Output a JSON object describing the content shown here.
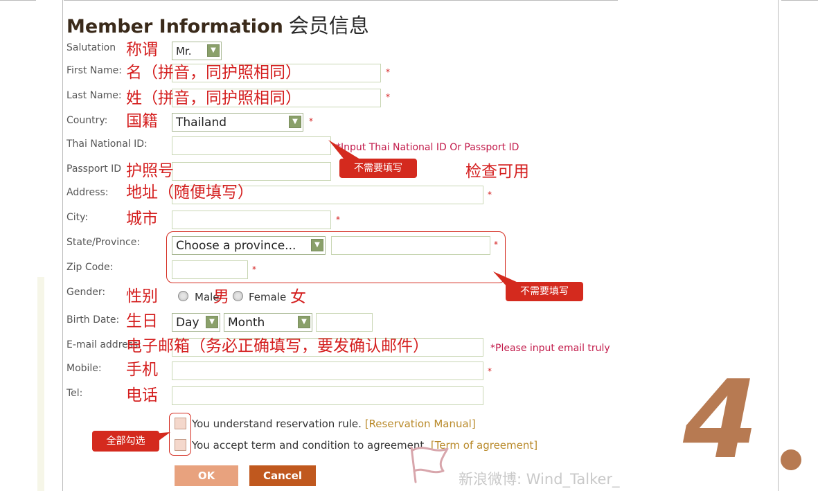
{
  "form": {
    "title": "Member Information",
    "title_cn": "会员信息",
    "salutation": {
      "label": "Salutation",
      "cn": "称谓",
      "value": "Mr."
    },
    "first_name": {
      "label": "First Name:",
      "cn": "名（拼音，同护照相同）",
      "required": "*"
    },
    "last_name": {
      "label": "Last Name:",
      "cn": "姓（拼音，同护照相同）",
      "required": "*"
    },
    "country": {
      "label": "Country:",
      "cn": "国籍",
      "value": "Thailand",
      "required": "*"
    },
    "thai_id": {
      "label": "Thai National ID:",
      "hint": "*Input Thai National ID Or Passport ID"
    },
    "passport": {
      "label": "Passport ID",
      "cn": "护照号",
      "note_cn": "检查可用"
    },
    "address": {
      "label": "Address:",
      "cn": "地址（随便填写）",
      "required": "*"
    },
    "city": {
      "label": "City:",
      "cn": "城市",
      "required": "*"
    },
    "state": {
      "label": "State/Province:",
      "value": "Choose a province...",
      "required": "*"
    },
    "zip": {
      "label": "Zip Code:",
      "required": "*"
    },
    "gender": {
      "label": "Gender:",
      "cn": "性别",
      "male": "Male",
      "male_cn": "男",
      "female": "Female",
      "female_cn": "女"
    },
    "birth": {
      "label": "Birth Date:",
      "cn": "生日",
      "day": "Day",
      "month": "Month"
    },
    "email": {
      "label": "E-mail address:",
      "cn": "电子邮箱（务必正确填写，要发确认邮件）",
      "hint": "*Please input email truly"
    },
    "mobile": {
      "label": "Mobile:",
      "cn": "手机",
      "required": "*"
    },
    "tel": {
      "label": "Tel:",
      "cn": "电话"
    },
    "agree1": {
      "text": "You understand reservation rule.",
      "link": "[Reservation Manual]"
    },
    "agree2": {
      "text": "You accept term and condition to agreement.",
      "link": "[Term of agreement]"
    },
    "ok_label": "OK",
    "cancel_label": "Cancel"
  },
  "annotations": {
    "callout_id": "不需要填写",
    "callout_province": "不需要填写",
    "callout_check": "全部勾选",
    "step_number": "4"
  },
  "watermark": {
    "text": "新浪微博:  Wind_Talker_",
    "logo_icon": "weibo-logo-icon"
  },
  "colors": {
    "annotation_red": "#d41e1e",
    "title_brown": "#3a2a1a",
    "select_arrow_green": "#8aa06a",
    "cancel_button": "#c0581e",
    "ok_button": "#e8a27e",
    "step_number_brown": "#b77a52"
  }
}
